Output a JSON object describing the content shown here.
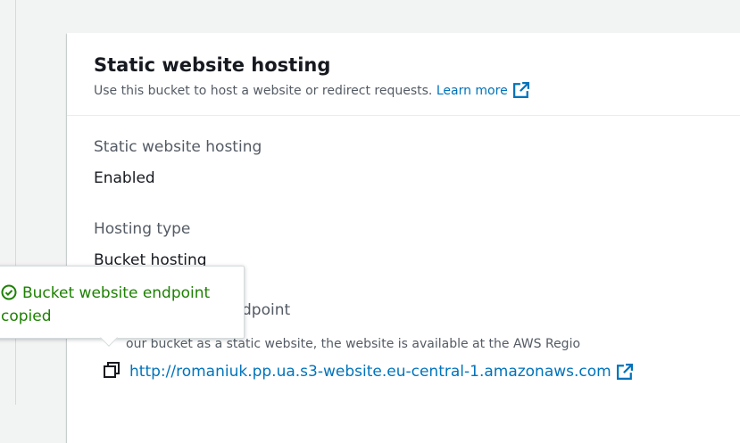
{
  "panel": {
    "title": "Static website hosting",
    "description": "Use this bucket to host a website or redirect requests.",
    "learn_more": "Learn more"
  },
  "fields": {
    "hosting_label": "Static website hosting",
    "hosting_value": "Enabled",
    "type_label": "Hosting type",
    "type_value": "Bucket hosting",
    "endpoint_label_visible": "dpoint",
    "endpoint_desc_visible": "our bucket as a static website, the website is available at the AWS Regio",
    "endpoint_url": "http://romaniuk.pp.ua.s3-website.eu-central-1.amazonaws.com"
  },
  "tooltip": {
    "line1": "Bucket website endpoint",
    "line2": "copied"
  },
  "colors": {
    "link": "#0073bb",
    "success": "#1d8102"
  },
  "icons": {
    "external": "external-link-icon",
    "copy": "copy-icon",
    "success": "check-circle-icon"
  }
}
